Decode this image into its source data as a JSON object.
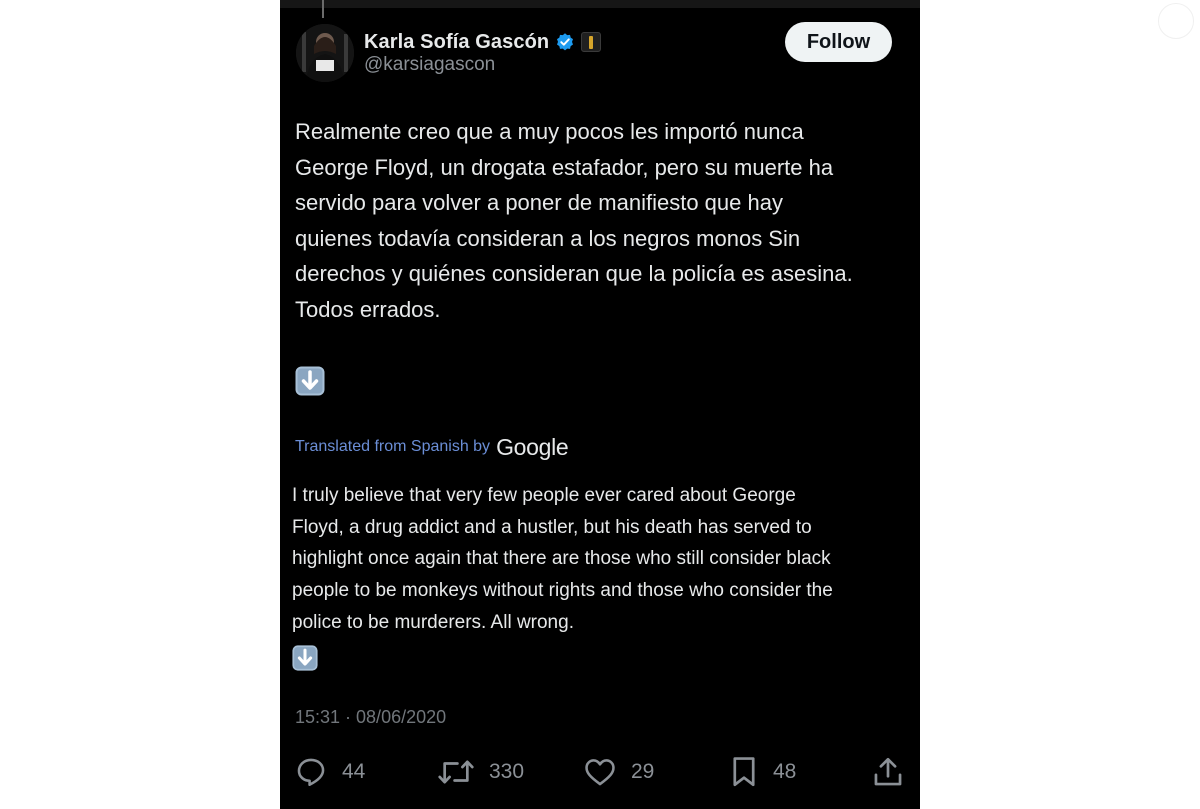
{
  "author": {
    "display_name": "Karla Sofía Gascón",
    "handle": "@karsiagascon",
    "verified": true,
    "verified_color": "#1d9bf0",
    "affiliate_badge_color": "#d6a52b"
  },
  "follow_button": {
    "label": "Follow"
  },
  "tweet": {
    "original_text": "Realmente creo que a muy pocos les importó nunca\nGeorge Floyd, un drogata estafador, pero su muerte ha\nservido para volver a poner de manifiesto que hay\nquienes todavía consideran a los negros monos Sin\nderechos y quiénes consideran que la policía es asesina.\nTodos errados.",
    "emoji": "down-arrow-emoji",
    "translation_label": "Translated from Spanish by",
    "translation_provider": "Google",
    "translated_text": "I truly believe that very few people ever cared about George\nFloyd, a drug addict and a hustler, but his death has served to\nhighlight once again that there are those who still consider black\npeople to be monkeys without rights and those who consider the\npolice to be murderers. All wrong.",
    "timestamp": "15:31 · 08/06/2020"
  },
  "actions": {
    "reply": {
      "icon": "reply-icon",
      "count": "44"
    },
    "retweet": {
      "icon": "retweet-icon",
      "count": "330"
    },
    "like": {
      "icon": "heart-icon",
      "count": "29"
    },
    "bookmark": {
      "icon": "bookmark-icon",
      "count": "48"
    },
    "share": {
      "icon": "share-icon"
    }
  },
  "colors": {
    "background": "#000000",
    "text": "#e7e9ea",
    "secondary_text": "#71767b",
    "link": "#6b8ed6"
  }
}
